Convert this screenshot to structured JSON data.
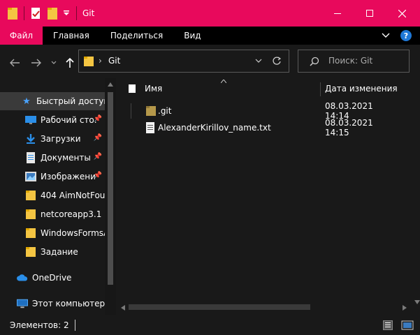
{
  "window": {
    "title": "Git",
    "accent": "#e8095c",
    "controls": {
      "minimize": "—",
      "maximize": "☐",
      "close": "✕"
    }
  },
  "ribbon": {
    "tabs": [
      "Файл",
      "Главная",
      "Поделиться",
      "Вид"
    ],
    "help_label": "?"
  },
  "address": {
    "path": "Git",
    "search_placeholder": "Поиск: Git"
  },
  "navpane": {
    "quick_access": "Быстрый доступ",
    "items": [
      {
        "label": "Рабочий сто.",
        "icon": "desktop-icon",
        "pinned": true
      },
      {
        "label": "Загрузки",
        "icon": "download-icon",
        "pinned": true
      },
      {
        "label": "Документы",
        "icon": "document-icon",
        "pinned": true
      },
      {
        "label": "Изображени",
        "icon": "pictures-icon",
        "pinned": true
      },
      {
        "label": "404 AimNotFour",
        "icon": "folder-icon",
        "pinned": false
      },
      {
        "label": "netcoreapp3.1",
        "icon": "folder-icon",
        "pinned": false
      },
      {
        "label": "WindowsFormsA",
        "icon": "folder-icon",
        "pinned": false
      },
      {
        "label": "Задание",
        "icon": "folder-icon",
        "pinned": false
      }
    ],
    "onedrive": "OneDrive",
    "this_pc": "Этот компьютер"
  },
  "content": {
    "columns": {
      "name": "Имя",
      "date": "Дата изменения"
    },
    "files": [
      {
        "name": ".git",
        "date": "08.03.2021 14:14",
        "icon": "folder-icon"
      },
      {
        "name": "AlexanderKirillov_name.txt",
        "date": "08.03.2021 14:15",
        "icon": "text-file-icon"
      }
    ]
  },
  "status": {
    "items_text": "Элементов: 2"
  }
}
